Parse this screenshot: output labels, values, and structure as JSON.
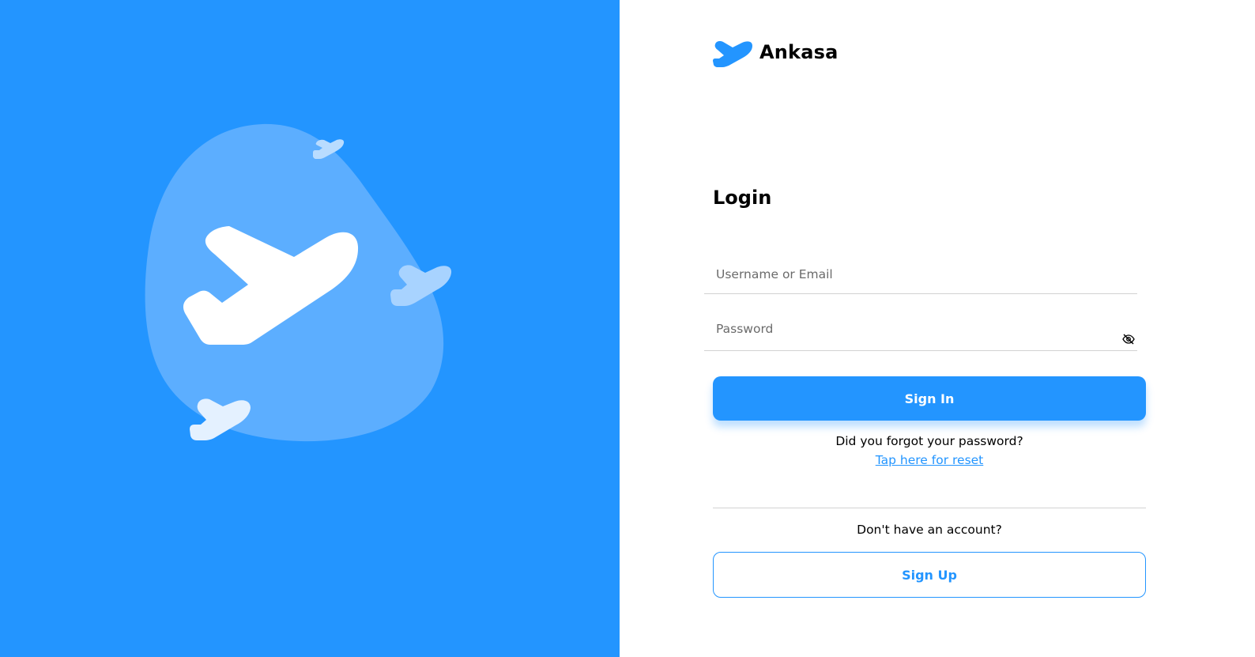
{
  "brand": {
    "name": "Ankasa",
    "icon": "plane-logo-icon"
  },
  "login": {
    "title": "Login",
    "username_placeholder": "Username or Email",
    "username_value": "",
    "password_placeholder": "Password",
    "password_value": "",
    "password_toggle_icon": "eye-slash-icon",
    "signin_label": "Sign In",
    "forgot_text": "Did you forgot your password?",
    "reset_link": "Tap here for reset",
    "no_account_text": "Don't have an account?",
    "signup_label": "Sign Up"
  },
  "illustration": {
    "icons": [
      "blob-shape",
      "large-plane-icon",
      "small-plane-icon",
      "small-plane-icon",
      "small-plane-icon"
    ]
  },
  "colors": {
    "primary": "#2395FF",
    "blob": "#5CAEFF",
    "light_plane": "#A8D3FF",
    "text": "#000000",
    "muted": "#6B6B6B",
    "divider": "#D2D2D2"
  }
}
